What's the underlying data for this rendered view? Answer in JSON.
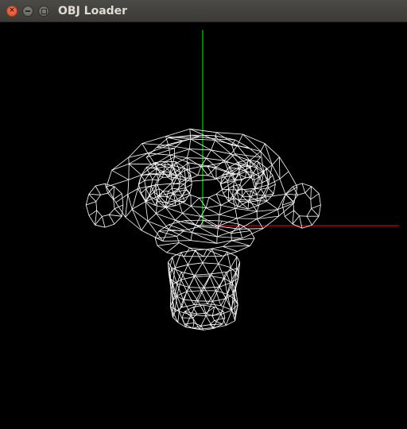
{
  "window": {
    "title": "OBJ Loader"
  },
  "colors": {
    "titlebar": "#3c3b37",
    "title_text": "#dfdbd2",
    "close_button": "#e0462a",
    "background": "#000000",
    "wireframe": "#ffffff",
    "x_axis": "#ff0000",
    "y_axis": "#00ff00"
  },
  "icons": {
    "close": "close-icon",
    "minimize": "minimize-icon",
    "maximize": "maximize-icon"
  },
  "scene": {
    "model": "monkey-head-wireframe",
    "render_mode": "wireframe",
    "axes_shown": [
      "x",
      "y"
    ]
  }
}
